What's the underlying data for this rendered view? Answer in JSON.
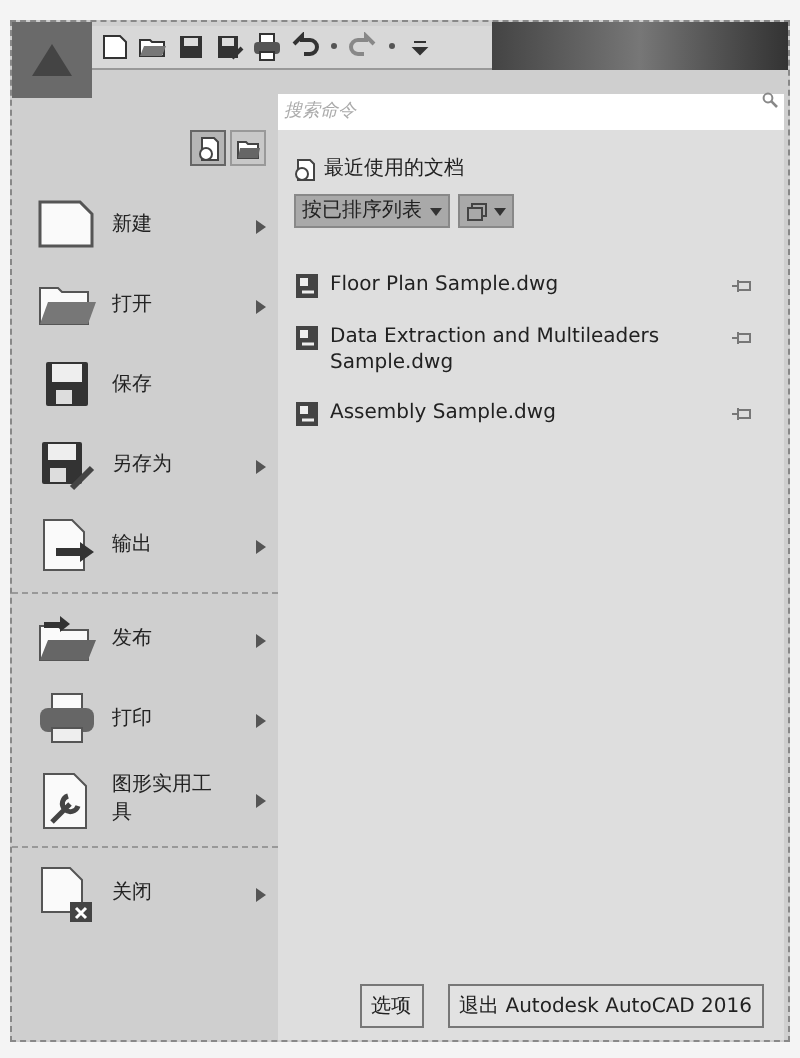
{
  "search": {
    "placeholder": "搜索命令"
  },
  "view_toggles": [
    {
      "kind": "recent",
      "selected": true
    },
    {
      "kind": "open",
      "selected": false
    }
  ],
  "menu": [
    {
      "kind": "new",
      "label": "新建",
      "has_submenu": true
    },
    {
      "kind": "open",
      "label": "打开",
      "has_submenu": true
    },
    {
      "kind": "save",
      "label": "保存",
      "has_submenu": false
    },
    {
      "kind": "saveas",
      "label": "另存为",
      "has_submenu": true
    },
    {
      "kind": "export",
      "label": "输出",
      "has_submenu": true,
      "separator_after": true
    },
    {
      "kind": "publish",
      "label": "发布",
      "has_submenu": true
    },
    {
      "kind": "print",
      "label": "打印",
      "has_submenu": true
    },
    {
      "kind": "utilities",
      "label": "图形实用工具",
      "has_submenu": true,
      "separator_after": true
    },
    {
      "kind": "close",
      "label": "关闭",
      "has_submenu": true
    }
  ],
  "recent": {
    "title": "最近使用的文档",
    "sort_dropdown": "按已排序列表",
    "files": [
      {
        "name": "Floor Plan Sample.dwg"
      },
      {
        "name": "Data Extraction and Multileaders Sample.dwg"
      },
      {
        "name": "Assembly Sample.dwg"
      }
    ]
  },
  "buttons": [
    "选项",
    "退出 Autodesk AutoCAD 2016"
  ]
}
